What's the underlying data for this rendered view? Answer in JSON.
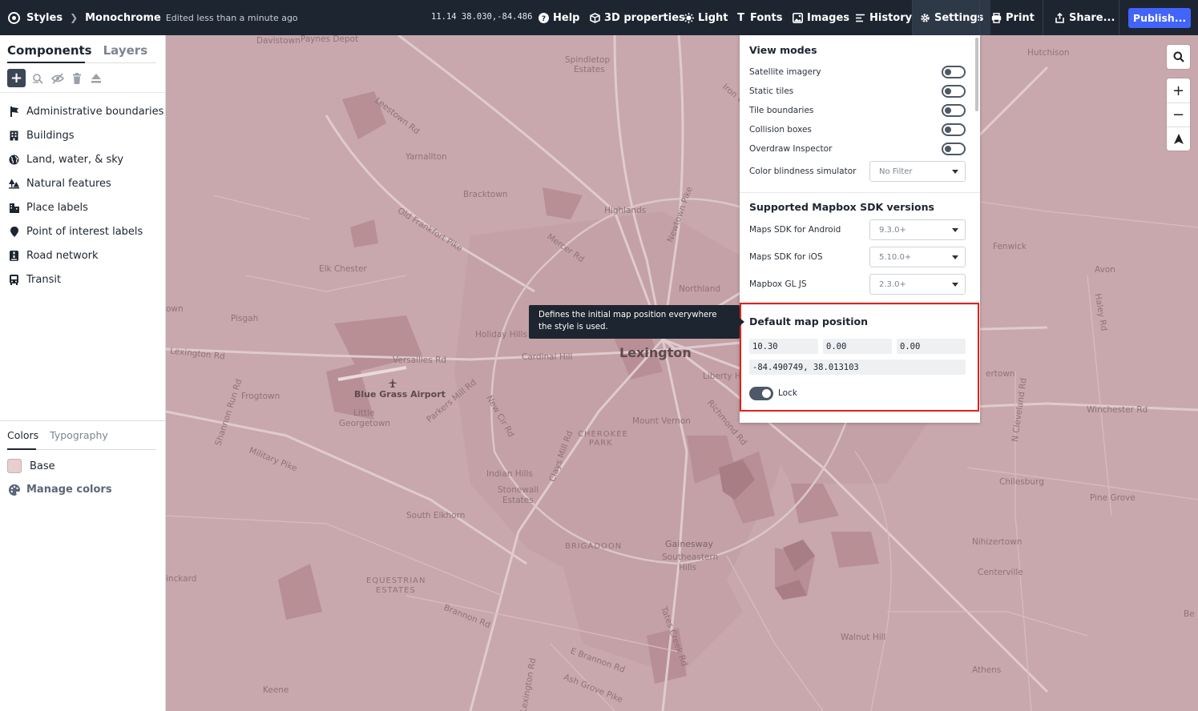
{
  "topbar": {
    "styles_label": "Styles",
    "style_name": "Monochrome",
    "edited_text": "Edited less than a minute ago",
    "coords": "11.14  38.030,-84.486",
    "menu": {
      "help": "Help",
      "properties_3d": "3D properties",
      "light": "Light",
      "fonts": "Fonts",
      "images": "Images",
      "history": "History",
      "settings": "Settings",
      "print": "Print",
      "share": "Share...",
      "publish": "Publish..."
    }
  },
  "sidebar": {
    "tabs": {
      "components": "Components",
      "layers": "Layers"
    },
    "components": [
      {
        "label": "Administrative boundaries",
        "icon": "flag-icon"
      },
      {
        "label": "Buildings",
        "icon": "building-icon"
      },
      {
        "label": "Land, water, & sky",
        "icon": "globe-icon"
      },
      {
        "label": "Natural features",
        "icon": "trees-icon"
      },
      {
        "label": "Place labels",
        "icon": "city-icon"
      },
      {
        "label": "Point of interest labels",
        "icon": "marker-icon"
      },
      {
        "label": "Road network",
        "icon": "road-icon"
      },
      {
        "label": "Transit",
        "icon": "bus-icon"
      }
    ],
    "bottom_tabs": {
      "colors": "Colors",
      "typography": "Typography"
    },
    "base_color": {
      "label": "Base",
      "hex": "#e7cfd1"
    },
    "manage_colors": "Manage colors"
  },
  "settings_panel": {
    "view_modes": {
      "title": "View modes",
      "rows": {
        "satellite": "Satellite imagery",
        "static_tiles": "Static tiles",
        "tile_boundaries": "Tile boundaries",
        "collision_boxes": "Collision boxes",
        "overdraw": "Overdraw Inspector"
      },
      "color_blindness_label": "Color blindness simulator",
      "color_blindness_value": "No Filter"
    },
    "sdk": {
      "title": "Supported Mapbox SDK versions",
      "android_label": "Maps SDK for Android",
      "android_value": "9.3.0+",
      "ios_label": "Maps SDK for iOS",
      "ios_value": "5.10.0+",
      "gljs_label": "Mapbox GL JS",
      "gljs_value": "2.3.0+"
    },
    "default_position": {
      "title": "Default map position",
      "zoom": "10.30",
      "bearing": "0.00",
      "pitch": "0.00",
      "center": "-84.490749, 38.013103",
      "lock_label": "Lock"
    }
  },
  "tooltip": {
    "text": "Defines the initial map position everywhere the style is used."
  },
  "map": {
    "labels": {
      "davistown": "Davistown",
      "paynes_depot": "Paynes Depot",
      "spindletop": "Spindletop",
      "estates": "Estates",
      "iron_works": "Iron W",
      "hutchison": "Hutchison",
      "leestown_rd": "Leestown Rd",
      "yarnallton": "Yarnallton",
      "bracktown": "Bracktown",
      "highlands": "Highlands",
      "newtown_pike": "Newtown Pike",
      "old_frankfort": "Old Frankfort Pike",
      "mercer_rd": "Mercer Rd",
      "elk_chester": "Elk Chester",
      "northland": "Northland",
      "fenwick": "Fenwick",
      "avon": "Avon",
      "haley_rd": "Haley Rd",
      "town_left": "own",
      "pisgah": "Pisgah",
      "holiday_hills": "Holiday Hills",
      "lexington_rd": "Lexington Rd",
      "versailles_rd": "Versailles Rd",
      "cardinal_hill": "Cardinal Hill",
      "lexington": "Lexington",
      "liberty_h": "Liberty H",
      "airport": "Blue Grass Airport",
      "frogtown": "Frogtown",
      "little": "Little",
      "georgetown": "Georgetown",
      "parkers_mill": "Parkers Mill Rd",
      "new_cir": "New Cir Rd",
      "shannon_run": "Shannon Run Rd",
      "military_pike": "Military Pike",
      "cherokee": "CHEROKEE",
      "park": "PARK",
      "mount_vernon": "Mount Vernon",
      "richmond_rd": "Richmond Rd",
      "clays_mill": "Clays Mill Rd",
      "indian_hills": "Indian Hills",
      "stonewall": "Stonewall",
      "estates2": "Estates",
      "south_elkhorn": "South Elkhorn",
      "ertown": "ertown",
      "n_cleveland": "N Cleveland Rd",
      "winchester_rd": "Winchester Rd",
      "chilesburg": "Chilesburg",
      "pine_grove": "Pine Grove",
      "inckard": "inckard",
      "equestrian": "EQUESTRIAN",
      "estates_caps": "ESTATES",
      "brigadoon": "BRIGADOON",
      "gainesway": "Gainesway",
      "southeastern": "Southeastern",
      "hills": "Hills",
      "nihizertown": "Nihizertown",
      "centerville": "Centerville",
      "brannon_rd": "Brannon Rd",
      "tates_creek": "Tates Creek Rd",
      "e_brannon": "E Brannon Rd",
      "walnut_hill": "Walnut Hill",
      "athens": "Athens",
      "ash_grove": "Ash Grove Pike",
      "lexington_rd2": "Lexington Rd",
      "keene": "Keene",
      "be": "Be"
    }
  },
  "colors": {
    "topbar_bg": "#1d2530",
    "publish_bg": "#4264fb",
    "map_bg": "#c8a8ac",
    "highlight": "#e0221b"
  }
}
